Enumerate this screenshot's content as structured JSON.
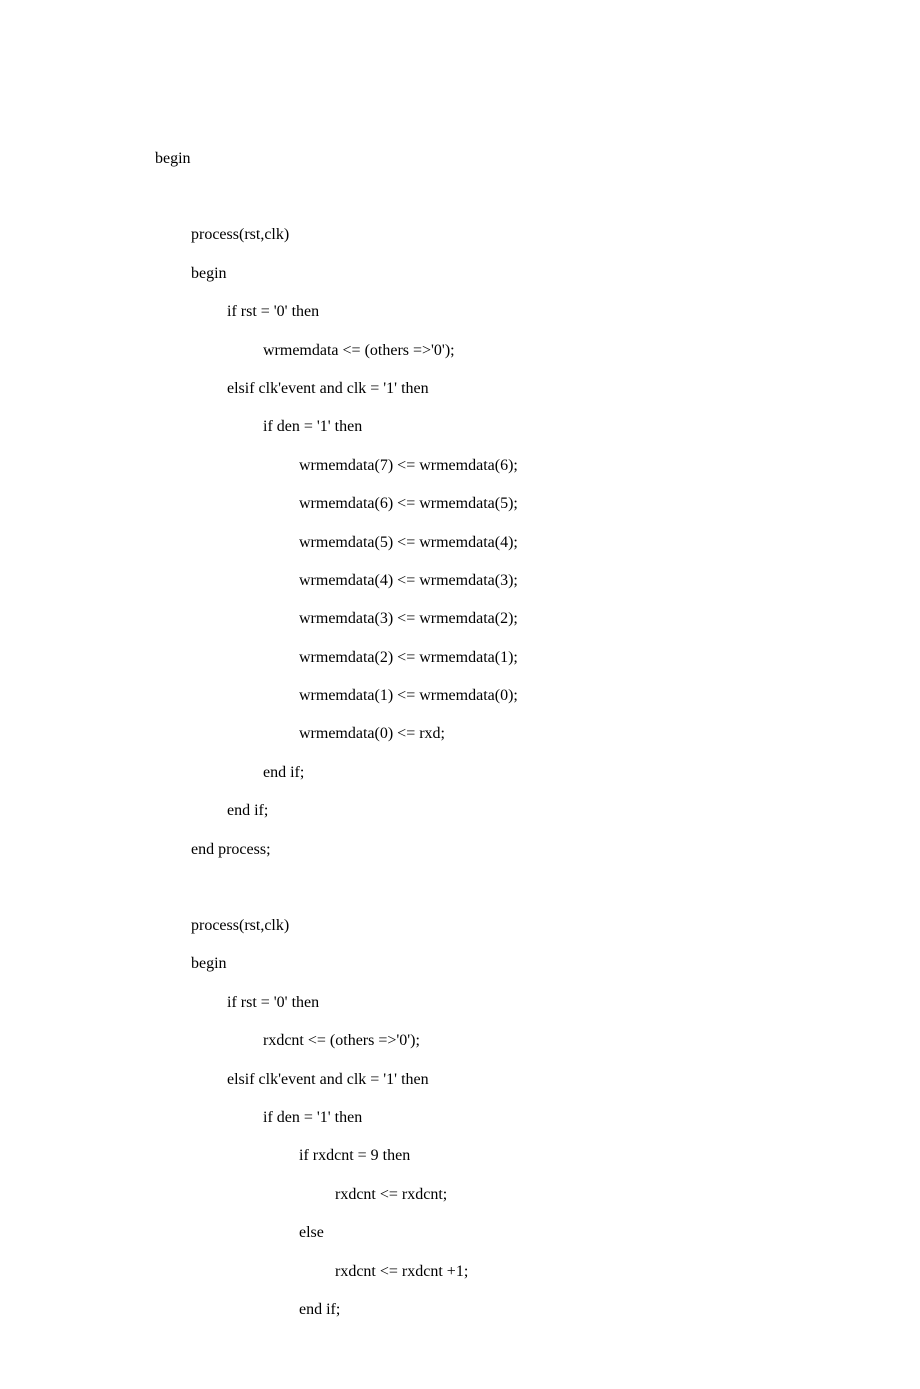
{
  "code": {
    "lines": [
      {
        "indent": 0,
        "text": "begin"
      },
      {
        "indent": 0,
        "text": "",
        "blank": true
      },
      {
        "indent": 1,
        "text": "process(rst,clk)"
      },
      {
        "indent": 1,
        "text": "begin"
      },
      {
        "indent": 2,
        "text": "if rst = '0' then"
      },
      {
        "indent": 3,
        "text": "wrmemdata <= (others =>'0');"
      },
      {
        "indent": 2,
        "text": "elsif clk'event and clk = '1' then"
      },
      {
        "indent": 3,
        "text": "if den = '1' then"
      },
      {
        "indent": 4,
        "text": "wrmemdata(7) <= wrmemdata(6);"
      },
      {
        "indent": 4,
        "text": "wrmemdata(6) <= wrmemdata(5);"
      },
      {
        "indent": 4,
        "text": "wrmemdata(5) <= wrmemdata(4);"
      },
      {
        "indent": 4,
        "text": "wrmemdata(4) <= wrmemdata(3);"
      },
      {
        "indent": 4,
        "text": "wrmemdata(3) <= wrmemdata(2);"
      },
      {
        "indent": 4,
        "text": "wrmemdata(2) <= wrmemdata(1);"
      },
      {
        "indent": 4,
        "text": "wrmemdata(1) <= wrmemdata(0);"
      },
      {
        "indent": 4,
        "text": "wrmemdata(0) <= rxd;"
      },
      {
        "indent": 3,
        "text": "end if;"
      },
      {
        "indent": 2,
        "text": "end if;"
      },
      {
        "indent": 1,
        "text": "end process;"
      },
      {
        "indent": 0,
        "text": "",
        "blank": true
      },
      {
        "indent": 1,
        "text": "process(rst,clk)"
      },
      {
        "indent": 1,
        "text": "begin"
      },
      {
        "indent": 2,
        "text": "if rst = '0' then"
      },
      {
        "indent": 3,
        "text": "rxdcnt <= (others =>'0');"
      },
      {
        "indent": 2,
        "text": "elsif clk'event and clk = '1' then"
      },
      {
        "indent": 3,
        "text": "if den = '1' then"
      },
      {
        "indent": 4,
        "text": "if rxdcnt = 9 then"
      },
      {
        "indent": 5,
        "text": "rxdcnt <= rxdcnt;"
      },
      {
        "indent": 4,
        "text": "else"
      },
      {
        "indent": 5,
        "text": "rxdcnt <= rxdcnt +1;"
      },
      {
        "indent": 4,
        "text": "end if;"
      }
    ]
  }
}
